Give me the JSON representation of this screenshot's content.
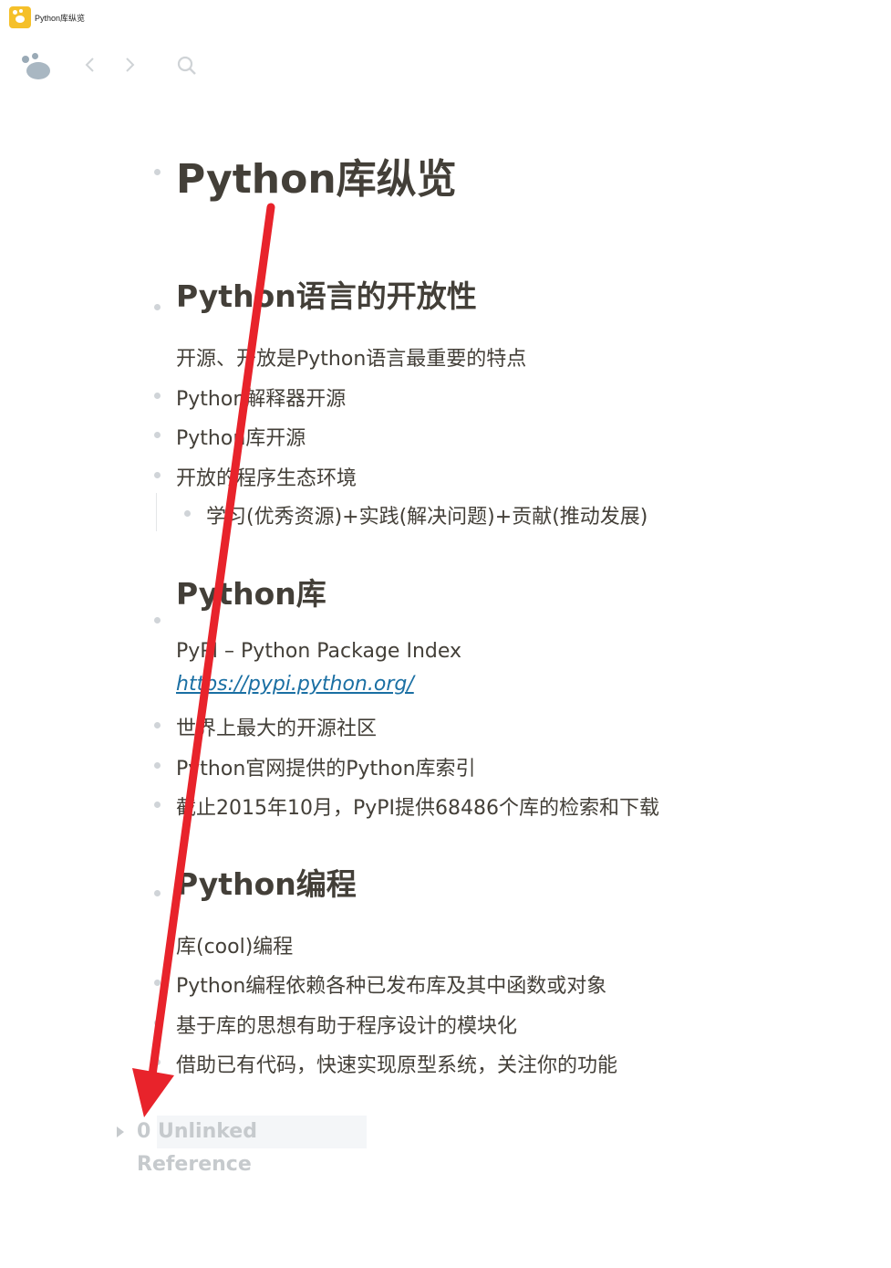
{
  "window": {
    "title": "Python库纵览"
  },
  "page": {
    "title": "Python库纵览",
    "sections": [
      {
        "heading": "Python语言的开放性",
        "items": [
          "开源、开放是Python语言最重要的特点",
          "Python解释器开源",
          "Python库开源",
          "开放的程序生态环境"
        ],
        "subitems": [
          "学习(优秀资源)+实践(解决问题)+贡献(推动发展)"
        ]
      },
      {
        "heading": "Python库",
        "intro": "PyPI – Python Package Index",
        "link": "https://pypi.python.org/",
        "items": [
          "世界上最大的开源社区",
          "Python官网提供的Python库索引",
          "截止2015年10月，PyPI提供68486个库的检索和下载"
        ]
      },
      {
        "heading": "Python编程",
        "items": [
          "库(cool)编程",
          "Python编程依赖各种已发布库及其中函数或对象",
          "基于库的思想有助于程序设计的模块化",
          "借助已有代码，快速实现原型系统，关注你的功能"
        ]
      }
    ],
    "unlinked_reference": "0 Unlinked Reference"
  },
  "icons": {
    "app": "logseq-app-icon",
    "logo": "logseq-logo-icon",
    "back": "chevron-left-icon",
    "forward": "chevron-right-icon",
    "search": "search-icon",
    "annotation": "red-arrow-annotation"
  },
  "colors": {
    "text": "#433f38",
    "link": "#1a6fa3",
    "bullet": "#d0d4d8",
    "arrow": "#e8232b",
    "app_icon": "#f5c02a"
  }
}
